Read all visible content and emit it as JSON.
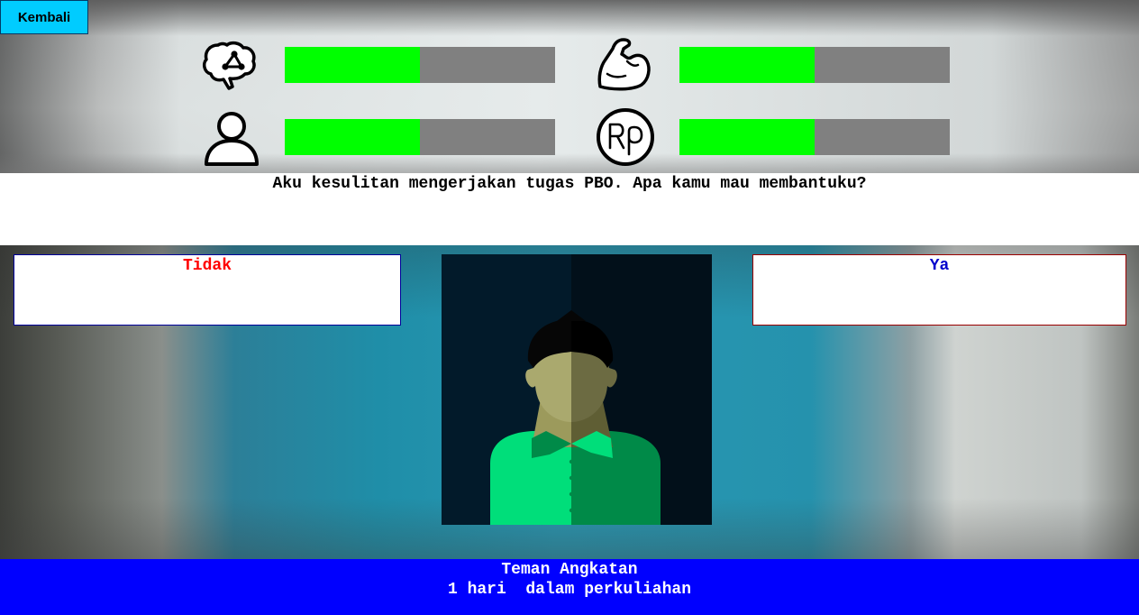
{
  "back_button": {
    "label": "Kembali"
  },
  "stats": [
    {
      "icon": "brain-icon",
      "fill_fraction": 0.5,
      "color": "#00ff00"
    },
    {
      "icon": "muscle-arm-icon",
      "fill_fraction": 0.5,
      "color": "#00ff00"
    },
    {
      "icon": "person-icon",
      "fill_fraction": 0.5,
      "color": "#00ff00"
    },
    {
      "icon": "rupiah-coin-icon",
      "fill_fraction": 0.5,
      "color": "#00ff00"
    }
  ],
  "dialog": {
    "question": "Aku kesulitan mengerjakan tugas PBO. Apa kamu mau membantuku?"
  },
  "choices": {
    "left": {
      "label": "Tidak",
      "text_color": "#ff0000",
      "border_color": "#000099"
    },
    "right": {
      "label": "Ya",
      "text_color": "#0000cc",
      "border_color": "#990000"
    }
  },
  "character": {
    "icon": "character-portrait"
  },
  "footer": {
    "name": "Teman Angkatan",
    "time": "1 hari  dalam perkuliahan",
    "background": "#0000ff"
  },
  "colors": {
    "back_button": "#00ccff",
    "bar_track": "#808080",
    "bar_fill": "#00ff00"
  }
}
